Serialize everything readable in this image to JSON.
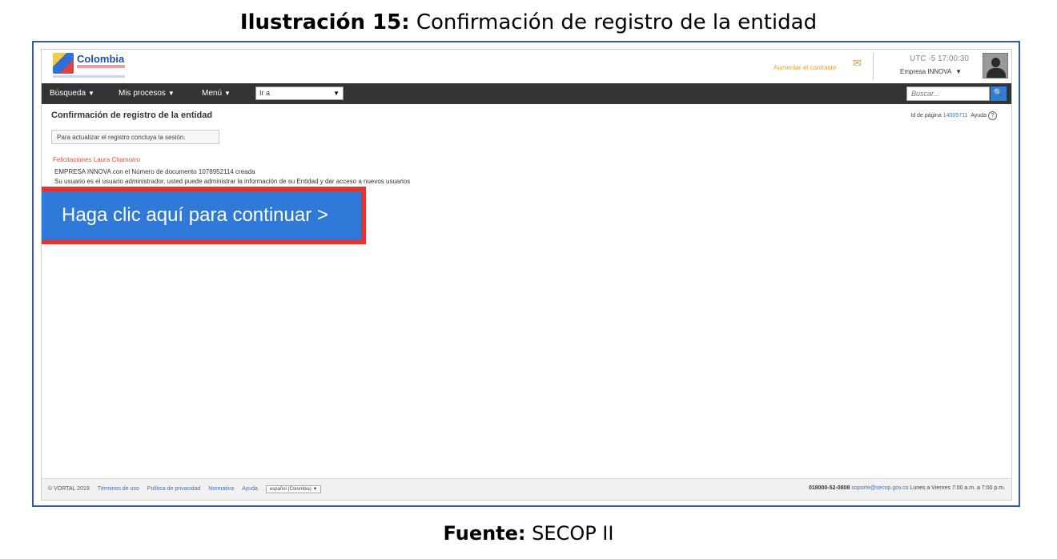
{
  "caption": {
    "label": "Ilustración 15:",
    "text": " Confirmación de registro de la entidad",
    "source_label": "Fuente:",
    "source_text": " SECOP II"
  },
  "header": {
    "logo_text": "Colombia",
    "notify_link": "Aumentar el contraste",
    "time": "UTC -5 17:00:30",
    "company": "Empresa INNOVA"
  },
  "nav": {
    "items": [
      {
        "label": "Búsqueda"
      },
      {
        "label": "Mis procesos"
      },
      {
        "label": "Menú"
      }
    ],
    "goto_value": "Ir a",
    "search_placeholder": "Buscar..."
  },
  "content": {
    "page_title": "Confirmación de registro de la entidad",
    "toplinks": {
      "id_label": "Id de página",
      "id_value": "14005711",
      "help": "Ayuda"
    },
    "info_box": "Para actualizar el registro concluya la sesión.",
    "congrats": "Felicitaciones Laura Chamorro",
    "line1": "EMPRESA INNOVA con el Número de documento 1078952114 creada",
    "line2": "Su usuario es el usuario administrador, usted puede administrar la información de su Entidad y dar acceso a nuevos usuarios",
    "cta": "Haga clic aquí para continuar >"
  },
  "footer": {
    "copyright": "© VORTAL 2019",
    "links": [
      "Términos de uso",
      "Política de privacidad",
      "Normativa",
      "Ayuda"
    ],
    "language": "español (Colombia)",
    "phone": "018000-52-0808",
    "email": "soporte@secop.gov.co",
    "hours": "Lunes a Viernes 7:00 a.m. a 7:00 p.m."
  }
}
